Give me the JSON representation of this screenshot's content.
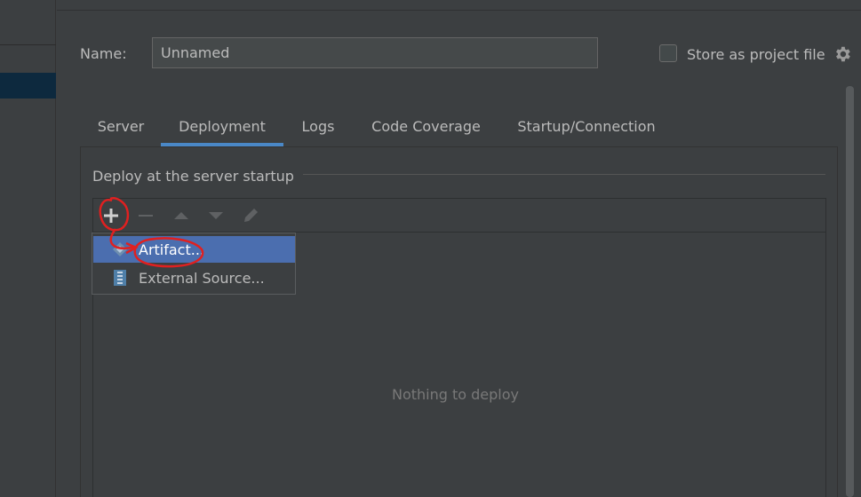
{
  "form": {
    "name_label": "Name:",
    "name_value": "Unnamed",
    "store_label": "Store as project file",
    "store_checked": false
  },
  "tabs": [
    {
      "label": "Server",
      "active": false
    },
    {
      "label": "Deployment",
      "active": true
    },
    {
      "label": "Logs",
      "active": false
    },
    {
      "label": "Code Coverage",
      "active": false
    },
    {
      "label": "Startup/Connection",
      "active": false
    }
  ],
  "deploy": {
    "section_title": "Deploy at the server startup",
    "empty_text": "Nothing to deploy",
    "toolbar": [
      "plus-icon",
      "minus-icon",
      "arrow-up-icon",
      "arrow-down-icon",
      "pencil-icon"
    ]
  },
  "popup": {
    "items": [
      {
        "label": "Artifact...",
        "icon": "artifact-icon",
        "selected": true
      },
      {
        "label": "External Source...",
        "icon": "external-source-icon",
        "selected": false
      }
    ]
  },
  "colors": {
    "background": "#3c3f41",
    "accent": "#4a88c7",
    "selection": "#4b6eaf",
    "annotation": "#e02020"
  }
}
